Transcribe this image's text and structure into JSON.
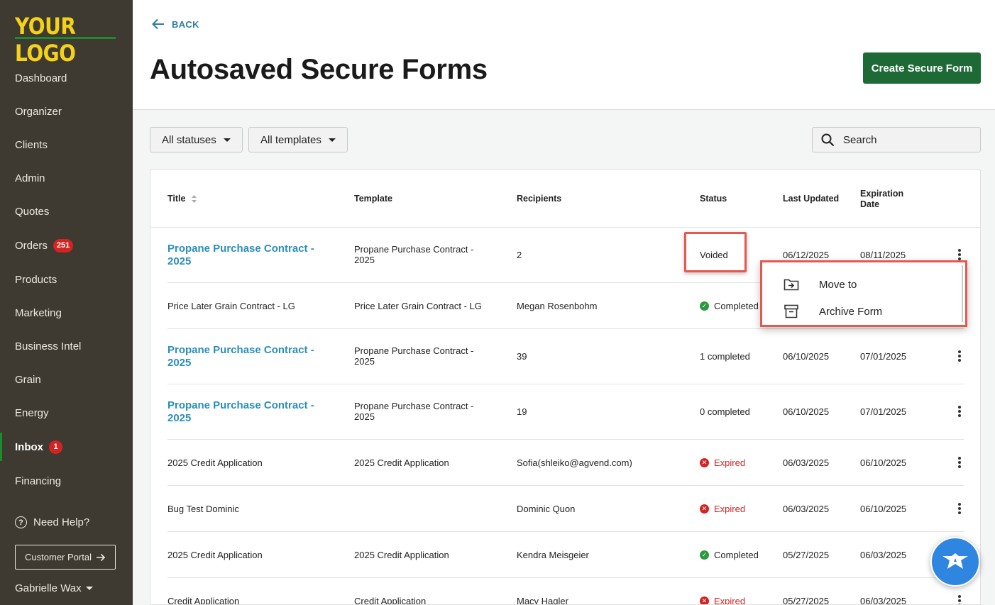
{
  "sidebar": {
    "logo": "YOUR LOGO",
    "items": [
      {
        "label": "Dashboard"
      },
      {
        "label": "Organizer"
      },
      {
        "label": "Clients"
      },
      {
        "label": "Admin"
      },
      {
        "label": "Quotes"
      },
      {
        "label": "Orders",
        "badge": "251"
      },
      {
        "label": "Products"
      },
      {
        "label": "Marketing"
      },
      {
        "label": "Business Intel"
      },
      {
        "label": "Grain"
      },
      {
        "label": "Energy"
      },
      {
        "label": "Inbox",
        "badge": "1",
        "active": true
      },
      {
        "label": "Financing"
      }
    ],
    "help": "Need Help?",
    "portal": "Customer Portal",
    "user": "Gabrielle Wax"
  },
  "header": {
    "back": "BACK",
    "title": "Autosaved Secure Forms",
    "create": "Create Secure Form"
  },
  "filters": {
    "status": "All statuses",
    "template": "All templates",
    "search_placeholder": "Search"
  },
  "table": {
    "columns": {
      "title": "Title",
      "template": "Template",
      "recipients": "Recipients",
      "status": "Status",
      "updated": "Last Updated",
      "expiration_1": "Expiration",
      "expiration_2": "Date"
    },
    "rows": [
      {
        "title1": "Propane Purchase Contract -",
        "title2": "2025",
        "link": true,
        "template1": "Propane Purchase Contract -",
        "template2": "2025",
        "recipients": "2",
        "status": "Voided",
        "updated": "06/12/2025",
        "expiration": "08/11/2025"
      },
      {
        "title1": "Price Later Grain Contract - LG",
        "title2": "",
        "link": false,
        "template1": "Price Later Grain Contract - LG",
        "template2": "",
        "recipients": "Megan Rosenbohm",
        "status": "Completed",
        "updated": "",
        "expiration": ""
      },
      {
        "title1": "Propane Purchase Contract -",
        "title2": "2025",
        "link": true,
        "template1": "Propane Purchase Contract -",
        "template2": "2025",
        "recipients": "39",
        "status": "1 completed",
        "updated": "06/10/2025",
        "expiration": "07/01/2025"
      },
      {
        "title1": "Propane Purchase Contract -",
        "title2": "2025",
        "link": true,
        "template1": "Propane Purchase Contract -",
        "template2": "2025",
        "recipients": "19",
        "status": "0 completed",
        "updated": "06/10/2025",
        "expiration": "07/01/2025"
      },
      {
        "title1": "2025 Credit Application",
        "title2": "",
        "link": false,
        "template1": "2025 Credit Application",
        "template2": "",
        "recipients": "Sofia(shleiko@agvend.com)",
        "status": "Expired",
        "updated": "06/03/2025",
        "expiration": "06/10/2025"
      },
      {
        "title1": "Bug Test Dominic",
        "title2": "",
        "link": false,
        "template1": "",
        "template2": "",
        "recipients": "Dominic Quon",
        "status": "Expired",
        "updated": "06/03/2025",
        "expiration": "06/10/2025"
      },
      {
        "title1": "2025 Credit Application",
        "title2": "",
        "link": false,
        "template1": "2025 Credit Application",
        "template2": "",
        "recipients": "Kendra Meisgeier",
        "status": "Completed",
        "updated": "05/27/2025",
        "expiration": "06/03/2025"
      },
      {
        "title1": "Credit Application",
        "title2": "",
        "link": false,
        "template1": "Credit Application",
        "template2": "",
        "recipients": "Macy Hagler",
        "status": "Expired",
        "updated": "05/27/2025",
        "expiration": "06/03/2025"
      }
    ]
  },
  "menu": {
    "move": "Move to",
    "archive": "Archive Form"
  },
  "colors": {
    "sidebar_bg": "#3f3a31",
    "logo": "#f4d21a",
    "primary_green": "#1e6a36",
    "link_blue": "#2a8fbc",
    "expired_red": "#d42323",
    "completed_green": "#2a9a3f",
    "highlight": "#e8574d"
  }
}
